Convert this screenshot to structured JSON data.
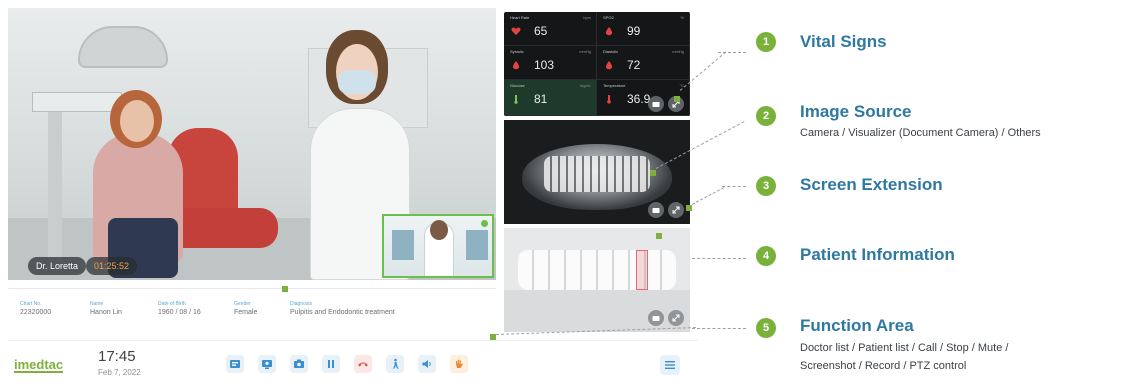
{
  "video": {
    "participant_name": "Dr. Loretta",
    "call_timer": "01:25:52"
  },
  "patient_info": {
    "fields": [
      {
        "label": "Chart No.",
        "value": "22320000"
      },
      {
        "label": "Name",
        "value": "Hanon Lin"
      },
      {
        "label": "Date of Birth",
        "value": "1960 / 08 / 16"
      },
      {
        "label": "Gender",
        "value": "Female"
      },
      {
        "label": "Diagnosis",
        "value": "Pulpitis and Endodontic treatment"
      }
    ]
  },
  "function_bar": {
    "logo": "imedtac",
    "time": "17:45",
    "date": "Feb 7, 2022",
    "buttons": [
      "doctor-list",
      "patient-list",
      "screenshot",
      "stop",
      "call",
      "ptz-control",
      "mute",
      "record"
    ]
  },
  "vitals": {
    "cells": [
      {
        "label": "Heart Rate",
        "unit": "bpm",
        "value": "65",
        "icon": "heart-icon"
      },
      {
        "label": "SPO2",
        "unit": "%",
        "value": "99",
        "icon": "drop-icon"
      },
      {
        "label": "Systolic",
        "unit": "mmHg",
        "value": "103",
        "icon": "drop-icon"
      },
      {
        "label": "Diastolic",
        "unit": "mmHg",
        "value": "72",
        "icon": "drop-icon"
      },
      {
        "label": "Glucose",
        "unit": "mg/dL",
        "value": "81",
        "icon": "glucose-icon"
      },
      {
        "label": "Temperature",
        "unit": "°C",
        "value": "36.9",
        "icon": "thermometer-icon"
      }
    ]
  },
  "legend": {
    "items": [
      {
        "number": "1",
        "title": "Vital Signs",
        "description": ""
      },
      {
        "number": "2",
        "title": "Image Source",
        "description": "Camera / Visualizer (Document Camera) / Others"
      },
      {
        "number": "3",
        "title": "Screen Extension",
        "description": ""
      },
      {
        "number": "4",
        "title": "Patient Information",
        "description": ""
      },
      {
        "number": "5",
        "title": "Function Area",
        "description": "Doctor list / Patient list / Call / Stop / Mute /",
        "description2": "Screenshot / Record / PTZ control"
      }
    ]
  },
  "colors": {
    "accent_green": "#79b13b",
    "title_blue": "#2f78a2",
    "vitals_bg": "#141617",
    "call_red": "#d9534f"
  }
}
